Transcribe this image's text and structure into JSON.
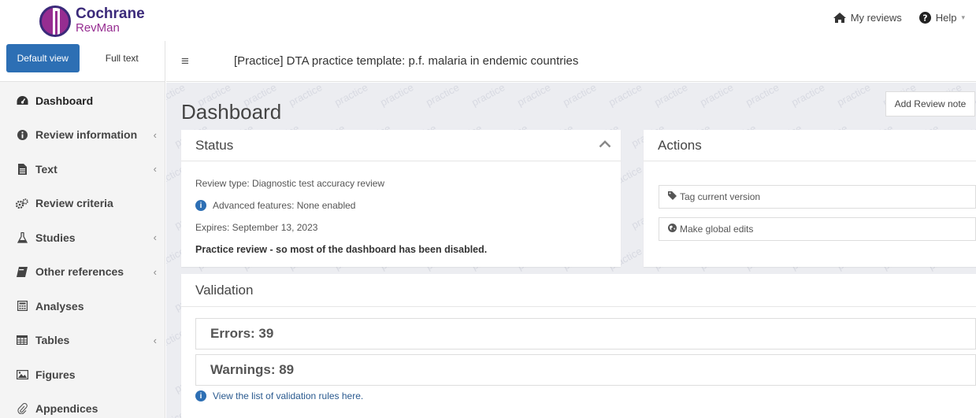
{
  "brand": {
    "name": "Cochrane",
    "product": "RevMan"
  },
  "top_links": {
    "my_reviews": "My reviews",
    "help": "Help"
  },
  "view_tabs": {
    "default": "Default view",
    "full_text": "Full text"
  },
  "sidebar": {
    "items": [
      {
        "label": "Dashboard",
        "icon": "dashboard-icon",
        "has_children": false
      },
      {
        "label": "Review information",
        "icon": "info-icon",
        "has_children": true
      },
      {
        "label": "Text",
        "icon": "file-icon",
        "has_children": true
      },
      {
        "label": "Review criteria",
        "icon": "gears-icon",
        "has_children": false
      },
      {
        "label": "Studies",
        "icon": "flask-icon",
        "has_children": true
      },
      {
        "label": "Other references",
        "icon": "book-icon",
        "has_children": true
      },
      {
        "label": "Analyses",
        "icon": "calculator-icon",
        "has_children": false
      },
      {
        "label": "Tables",
        "icon": "table-icon",
        "has_children": true
      },
      {
        "label": "Figures",
        "icon": "image-icon",
        "has_children": false
      },
      {
        "label": "Appendices",
        "icon": "paperclip-icon",
        "has_children": false
      }
    ]
  },
  "header": {
    "review_title": "[Practice] DTA practice template: p.f. malaria in endemic countries"
  },
  "watermark": "practice",
  "page": {
    "title": "Dashboard",
    "add_note": "Add Review note"
  },
  "status_panel": {
    "title": "Status",
    "review_type": "Review type: Diagnostic test accuracy review",
    "advanced_features": "Advanced features:  None enabled",
    "expires": "Expires: September 13, 2023",
    "practice_note": "Practice review - so most of the dashboard has been disabled."
  },
  "actions_panel": {
    "title": "Actions",
    "tag_version": "Tag current version",
    "global_edits": "Make global edits"
  },
  "validation_panel": {
    "title": "Validation",
    "errors": "Errors: 39",
    "warnings": "Warnings: 89",
    "rules_link": "View the list of validation rules here."
  },
  "colors": {
    "primary": "#2d6fb4",
    "brand_purple": "#962d91",
    "brand_navy": "#3b2a7a",
    "background": "#ecedf1"
  }
}
